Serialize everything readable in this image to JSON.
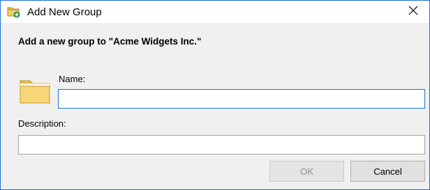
{
  "window": {
    "title": "Add New Group",
    "title_icon": "folder-add-icon",
    "close_icon": "close-icon"
  },
  "dialog": {
    "heading": "Add a new group to \"Acme Widgets Inc.\"",
    "folder_icon": "folder-icon",
    "name_label": "Name:",
    "name_value": "",
    "description_label": "Description:",
    "description_value": ""
  },
  "buttons": {
    "ok_label": "OK",
    "ok_enabled": false,
    "cancel_label": "Cancel"
  },
  "colors": {
    "window_border": "#1d6fd6",
    "focus_border": "#1976d2",
    "dialog_bg": "#f0f0f0",
    "add_badge": "#1e9e3c"
  }
}
